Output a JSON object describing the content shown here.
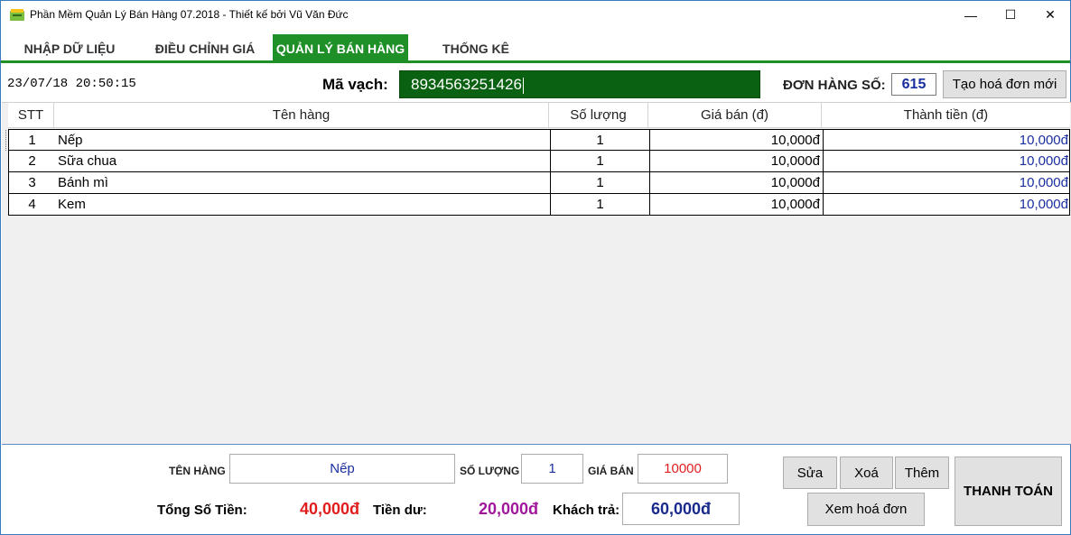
{
  "window": {
    "title": "Phần Mềm Quản Lý Bán Hàng 07.2018 - Thiết kế bởi Vũ Văn Đức",
    "minimize_glyph": "—",
    "maximize_glyph": "☐",
    "close_glyph": "✕"
  },
  "tabs": [
    {
      "label": "NHẬP DỮ LIỆU",
      "active": false
    },
    {
      "label": "ĐIỀU CHỈNH GIÁ",
      "active": false
    },
    {
      "label": "QUẢN LÝ BÁN HÀNG",
      "active": true
    },
    {
      "label": "THỐNG KÊ",
      "active": false
    }
  ],
  "toolbar": {
    "datetime": "23/07/18 20:50:15",
    "barcode_label": "Mã vạch:",
    "barcode_value": "8934563251426",
    "order_label": "ĐƠN HÀNG SỐ:",
    "order_number": "615",
    "new_invoice_label": "Tạo hoá đơn mới"
  },
  "grid": {
    "columns": [
      "STT",
      "Tên hàng",
      "Số lượng",
      "Giá bán (đ)",
      "Thành tiền (đ)"
    ],
    "rows": [
      {
        "stt": "1",
        "name": "Nếp",
        "qty": "1",
        "price": "10,000đ",
        "total": "10,000đ"
      },
      {
        "stt": "2",
        "name": "Sữa chua",
        "qty": "1",
        "price": "10,000đ",
        "total": "10,000đ"
      },
      {
        "stt": "3",
        "name": "Bánh mì",
        "qty": "1",
        "price": "10,000đ",
        "total": "10,000đ"
      },
      {
        "stt": "4",
        "name": "Kem",
        "qty": "1",
        "price": "10,000đ",
        "total": "10,000đ"
      }
    ]
  },
  "detail": {
    "item_label": "TÊN HÀNG",
    "item_value": "Nếp",
    "qty_label": "SỐ LƯỢNG",
    "qty_value": "1",
    "price_label": "GIÁ BÁN",
    "price_value": "10000"
  },
  "summary": {
    "total_label": "Tổng Số Tiền:",
    "total_value": "40,000đ",
    "change_label": "Tiền dư:",
    "change_value": "20,000đ",
    "paid_label": "Khách trả:",
    "paid_value": "60,000đ"
  },
  "actions": {
    "edit": "Sửa",
    "delete": "Xoá",
    "add": "Thêm",
    "view_invoice": "Xem hoá đơn",
    "checkout": "THANH TOÁN"
  },
  "colors": {
    "accent_green": "#1f8f28",
    "barcode_bg": "#0b6112",
    "red": "#e01e1e",
    "purple": "#a0179c",
    "navy": "#1a2fa0"
  },
  "icons": {
    "app": "app-logo-icon"
  }
}
